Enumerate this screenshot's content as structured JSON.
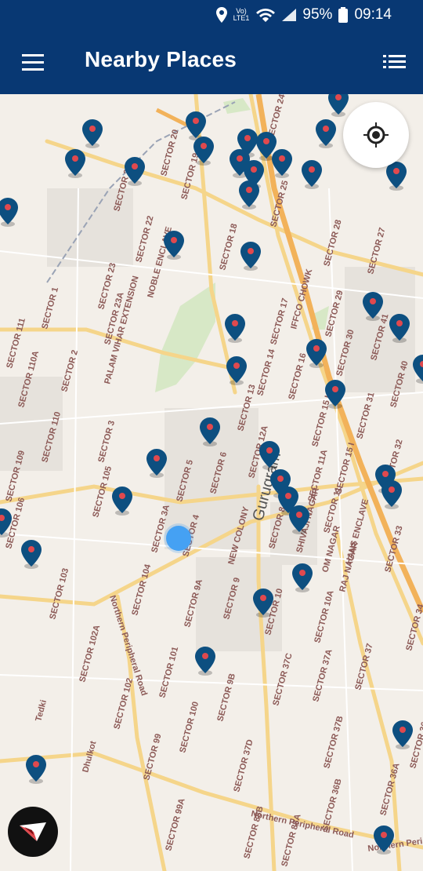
{
  "status": {
    "battery": "95%",
    "time": "09:14",
    "network": "LTE1",
    "volte": "Vo)"
  },
  "header": {
    "title": "Nearby Places"
  },
  "icons": {
    "menu": "hamburger-menu-icon",
    "list": "list-icon",
    "locate": "my-location-icon",
    "compass": "compass-icon",
    "pin": "map-pin-icon"
  },
  "colors": {
    "brand": "#083873",
    "pin": "#0d4f80",
    "pin_dot": "#e0494e",
    "user": "#45a1f3"
  },
  "map": {
    "city_label": "Gurugram",
    "area_labels": [
      "SECTOR 24",
      "SECTOR 20",
      "SECTOR 21",
      "SECTOR 19",
      "SECTOR 25",
      "SECTOR 22",
      "SECTOR 18",
      "SECTOR 28",
      "SECTOR 27",
      "NOBLE ENCLAVE",
      "SECTOR 23",
      "SECTOR 23A",
      "PALAM VIHAR EXTENSION",
      "SECTOR 111",
      "SECTOR 1",
      "SECTOR 110A",
      "SECTOR 2",
      "SECTOR 17",
      "IFFCO CHOWK",
      "SECTOR 29",
      "SECTOR 41",
      "SECTOR 14",
      "SECTOR 16",
      "SECTOR 30",
      "SECTOR 40",
      "SECTOR 110",
      "SECTOR 3",
      "SECTOR 13",
      "SECTOR 15 I",
      "SECTOR 31",
      "SECTOR 109",
      "SECTOR 105",
      "SECTOR 5",
      "SECTOR 6",
      "SECTOR 12A",
      "SECTOR 11A",
      "SECTOR 15 I",
      "SECTOR 32",
      "SECTOR 106",
      "SECTOR 3A",
      "SECTOR 4",
      "NEW COLONY",
      "SECTOR 8",
      "SHIVAJI NAGAR",
      "SECTOR 11",
      "OM NAGAR",
      "HANS ENCLAVE",
      "SECTOR 33",
      "SECTOR 103",
      "SECTOR 104",
      "SECTOR 9A",
      "SECTOR 9",
      "SECTOR 10",
      "RAJ NAGAR",
      "SECTOR 10A",
      "SECTOR 34",
      "SECTOR 102A",
      "Northern Peripheral Road",
      "SECTOR 101",
      "SECTOR 37C",
      "SECTOR 37A",
      "SECTOR 37",
      "Tedki",
      "SECTOR 102",
      "SECTOR 9B",
      "SECTOR 100",
      "SECTOR 99",
      "SECTOR 37D",
      "SECTOR 37B",
      "SECTOR 36",
      "Dhulkot",
      "SECTOR 99A",
      "SECTOR 88B",
      "SECTOR 36B",
      "SECTOR 36A",
      "SECTOR 88A",
      "Northern Peripheral Road",
      "Northern Peri"
    ],
    "pin_count": 45
  }
}
